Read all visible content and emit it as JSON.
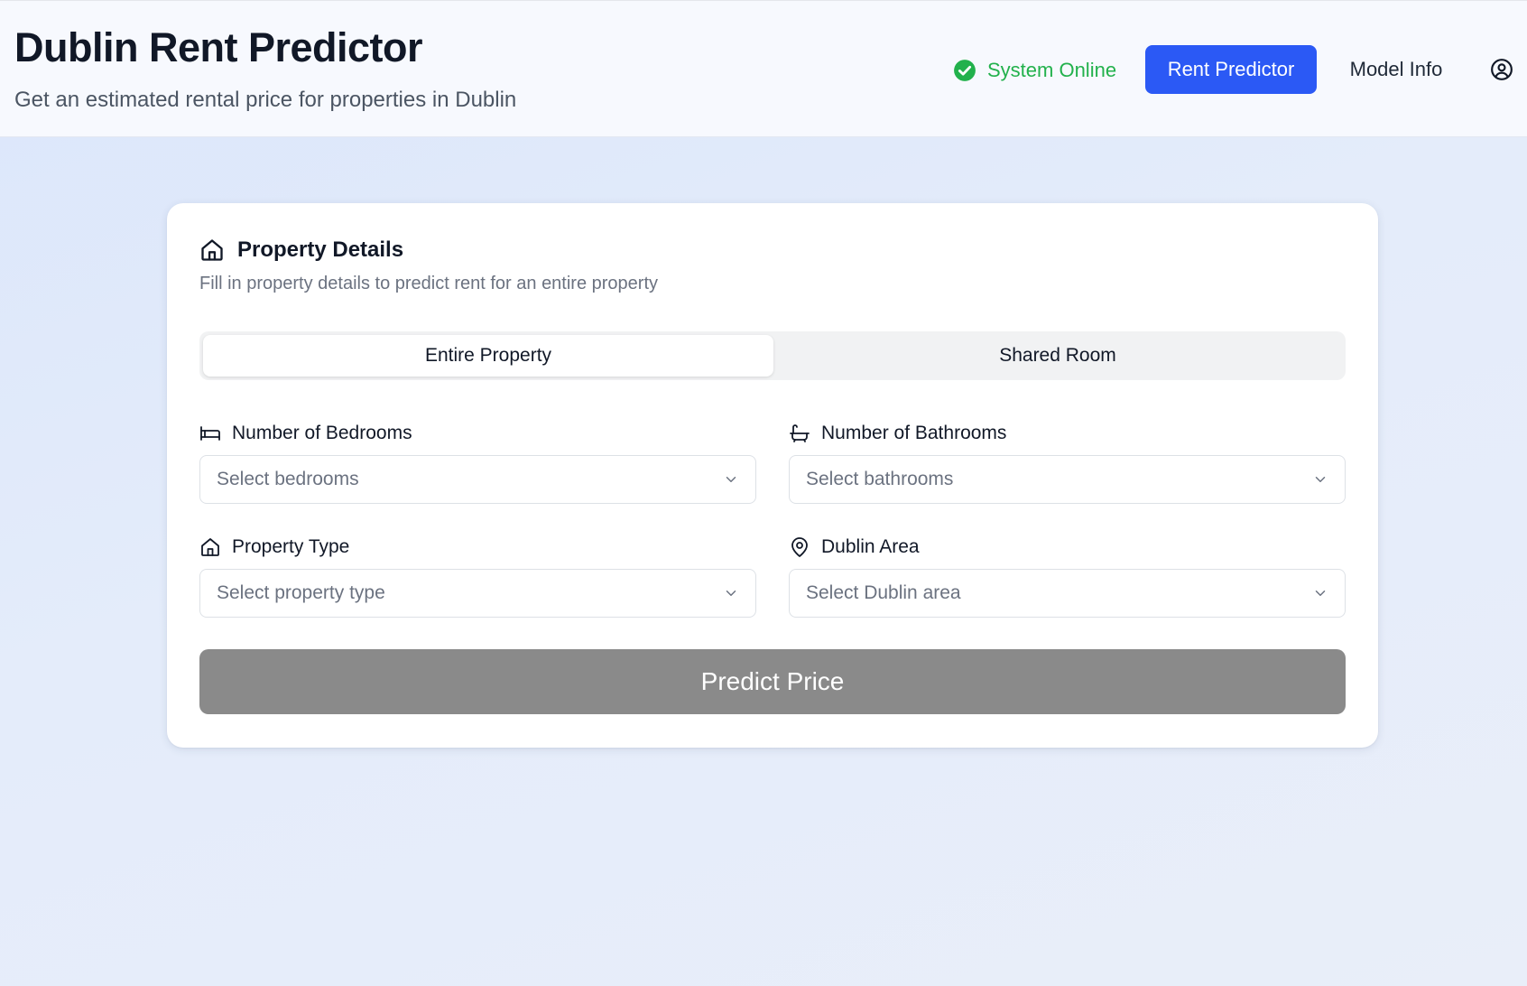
{
  "header": {
    "title": "Dublin Rent Predictor",
    "subtitle": "Get an estimated rental price for properties in Dublin",
    "status_text": "System Online",
    "status_icon": "check-circle-icon",
    "status_color": "#22b14c",
    "nav": {
      "primary_label": "Rent Predictor",
      "secondary_label": "Model Info"
    },
    "user_icon": "user-circle-icon",
    "accent_color": "#2b59f5"
  },
  "card": {
    "title": "Property Details",
    "title_icon": "home-icon",
    "description": "Fill in property details to predict rent for an entire property",
    "tabs": [
      {
        "label": "Entire Property",
        "active": true
      },
      {
        "label": "Shared Room",
        "active": false
      }
    ],
    "fields": {
      "bedrooms": {
        "label": "Number of Bedrooms",
        "placeholder": "Select bedrooms",
        "icon": "bed-icon"
      },
      "bathrooms": {
        "label": "Number of Bathrooms",
        "placeholder": "Select bathrooms",
        "icon": "bath-icon"
      },
      "property_type": {
        "label": "Property Type",
        "placeholder": "Select property type",
        "icon": "home-icon"
      },
      "area": {
        "label": "Dublin Area",
        "placeholder": "Select Dublin area",
        "icon": "map-pin-icon"
      }
    },
    "submit_label": "Predict Price",
    "submit_color": "#8a8a8a"
  }
}
